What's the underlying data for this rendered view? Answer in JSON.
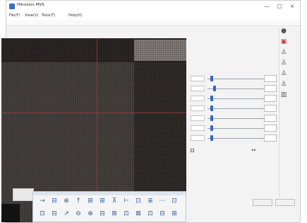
{
  "window": {
    "title": "Hikvision MVS",
    "controls": [
      "—",
      "□",
      "×"
    ]
  },
  "menu": [
    "File(F)",
    "View(V)",
    "Tools(T)",
    "Help(H)"
  ],
  "panel": {
    "col_headers": [
      "",
      ""
    ],
    "rows": [
      {
        "label": "",
        "value": "",
        "level": 0.05
      },
      {
        "label": "",
        "value": "",
        "level": 0.1
      },
      {
        "label": "",
        "value": "",
        "level": 0.05
      },
      {
        "label": "",
        "value": "",
        "level": 0.05
      },
      {
        "label": "",
        "value": "",
        "level": 0.05
      },
      {
        "label": "",
        "value": "",
        "level": 0.05
      },
      {
        "label": "",
        "value": "",
        "level": 0.05
      }
    ],
    "checkbox_label": "",
    "mini_ctrl": "◂ ▸"
  },
  "right_icons": [
    "camera-icon",
    "save-icon",
    "person-icon",
    "person-icon",
    "person-icon",
    "person-icon",
    "settings-icon"
  ],
  "right_icon_glyphs": [
    "●",
    "▣",
    "♙",
    "♙",
    "♙",
    "♙",
    "▥"
  ],
  "toolbar": {
    "tools": [
      "→",
      "⊟",
      "⊕",
      "↑",
      "⊞",
      "⊞",
      "⊼",
      "⊢",
      "⊡",
      "≣",
      "⋯",
      "⊡",
      "⊡",
      "⊟",
      "↗",
      "⊖",
      "⊕",
      "⊟",
      "⊞",
      "⊡",
      "⊠",
      "⊡",
      "⊟",
      "⊞"
    ]
  },
  "footer": {
    "buttons": [
      "",
      ""
    ]
  },
  "colors": {
    "crosshair": "#a23a36",
    "accent": "#3468c2"
  }
}
